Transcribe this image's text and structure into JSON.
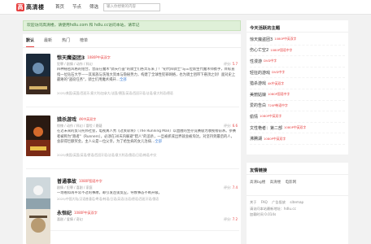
{
  "header": {
    "logo_mark": "高",
    "logo_text": "高清楼",
    "nav": [
      "首页",
      "节点",
      "筛选"
    ],
    "search_placeholder": "输入你想要的内容"
  },
  "notice": "欢迎访问高清楼，请使用hdlu.com 和 hdlu.cc访问本站，请牢记",
  "tabs": [
    "默认",
    "最新",
    "热门",
    "榜单"
  ],
  "items": [
    {
      "title": "惊天魔盗团3",
      "quality": "1080P中英双字",
      "meta": "犯罪 / 剧情 / 动作 / 科幻",
      "score_label": "评分:",
      "score": "5.7",
      "desc": "四种秘密风格的组合，曾前在魔术\"骑天行盗\"的骑士们各奔东来了！\"初代四骑士\"与三位新生代魔术师携手，目标直指一位钻石大亨——其家族与洗钱大资本与隐秘势力，构建了全球性犯罪网络，也为骑士团带下悬顶之剑！面对史上最难的\"盗窃任务\"，骑士们用魔术揭开…",
      "more": "全部",
      "tags": "2025/美国/英国/西班牙/意大利/加拿大/法国/德国/英语/西班牙语/法语/意大利语/德语"
    },
    {
      "title": "猎杀游戏",
      "quality": "4K中英双字",
      "meta": "惊悚 / 动作 / 科幻 / 冒险 / 悬疑",
      "score_label": "评分:",
      "score": "6.6",
      "desc": "在近未来的反乌托邦社会，电视真人秀《过关斩将》（The Running Man）以血腥的生存竞赛极为收视榜前茅。参赛者被称为\"跑者\"（Runners），必须在30天内躲避\"猎人\"的追杀，一旦被抓或出界就会被淘汰。对坚持到最后的人，会获得巨额奖金。主人公是一位父亲，为了给生病的女儿治病…",
      "more": "全部",
      "tags": "2025/美国/英国/英语/德语/西班牙语/法语/意大利语/俄语/日语/韩语/中文"
    },
    {
      "title": "普通事故",
      "quality": "1080P国语中字",
      "meta": "剧情 / 犯罪 / 喜剧 / 家庭",
      "score_label": "评分:",
      "score": "7.4",
      "desc": "一场看似再平常不过的事故，却引发连锁反应，导致事态不断升级。",
      "more": "",
      "tags": "2025/中国大陆/汉语普通话/粤语/韩语/日语/英语/法语/德语/西班牙语/俄语"
    },
    {
      "title": "永恒纪",
      "quality": "1080P中英双字",
      "meta": "喜剧 / 爱情 / 奇幻",
      "score_label": "评分:",
      "score": "7.2",
      "desc": "",
      "more": "",
      "tags": ""
    }
  ],
  "sidebar": {
    "hot_title": "今天活跃的主题",
    "hot": [
      {
        "name": "惊天魔盗团3",
        "q": "1080P中英双字"
      },
      {
        "name": "伤心亡空2",
        "q": "1080P国语中字"
      },
      {
        "name": "性漫游",
        "q": "DVD中字"
      },
      {
        "name": "轻狂的游戏",
        "q": "DVD中字"
      },
      {
        "name": "猎杀游戏",
        "q": "4K中英双字"
      },
      {
        "name": "美丽姑娘",
        "q": "1080P国语中字"
      },
      {
        "name": "爱的告白",
        "q": "720P韩语中字"
      },
      {
        "name": "偷情",
        "q": "1080P中英双字"
      },
      {
        "name": "文性艳者：第二部",
        "q": "1080P中英双字"
      },
      {
        "name": "沸腾湖",
        "q": "1080P中英双字"
      }
    ],
    "links_title": "友情链接",
    "links": [
      "高清bg楼",
      "高清楼",
      "电影网"
    ],
    "footer_links": [
      "关于",
      "FAQ",
      "广告投放",
      "sitemap"
    ],
    "footer_lines": [
      "请访问本站最新地址：hdlu.cc",
      "加载时间 0.014s"
    ]
  }
}
